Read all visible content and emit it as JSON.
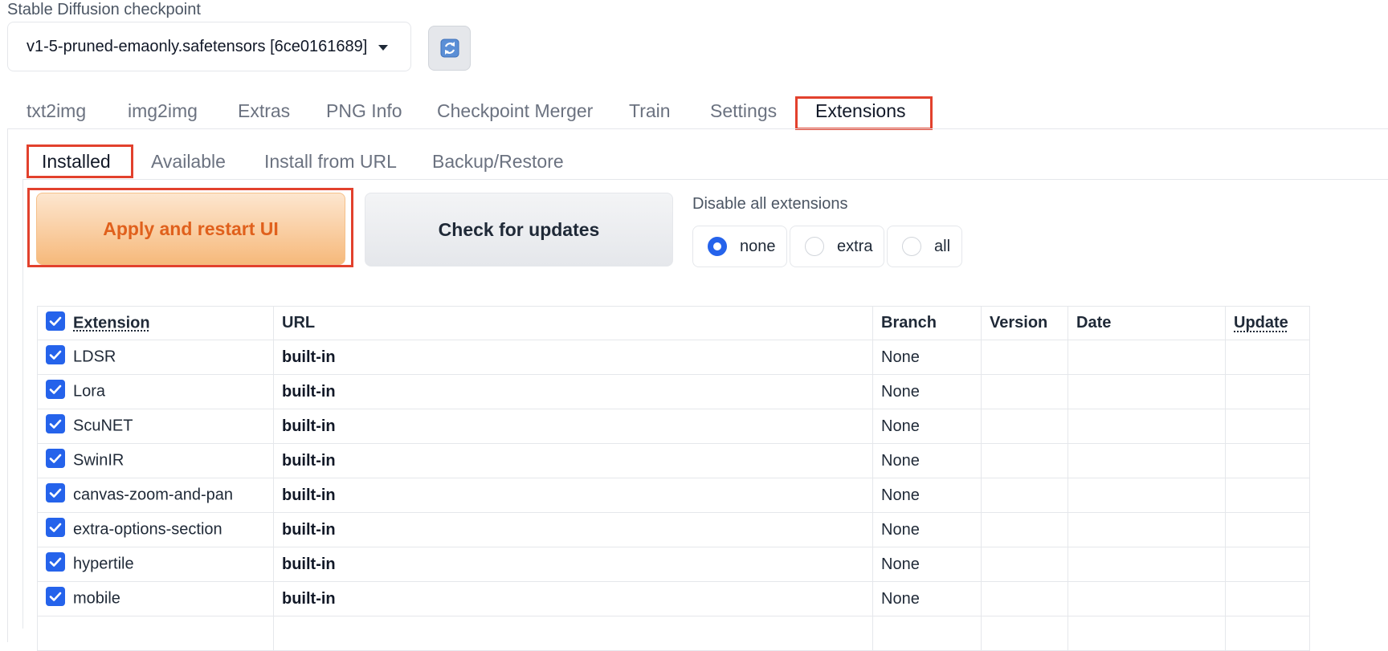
{
  "checkpoint": {
    "label": "Stable Diffusion checkpoint",
    "value": "v1-5-pruned-emaonly.safetensors [6ce0161689]"
  },
  "tabs": [
    {
      "label": "txt2img"
    },
    {
      "label": "img2img"
    },
    {
      "label": "Extras"
    },
    {
      "label": "PNG Info"
    },
    {
      "label": "Checkpoint Merger"
    },
    {
      "label": "Train"
    },
    {
      "label": "Settings"
    },
    {
      "label": "Extensions"
    }
  ],
  "subtabs": [
    {
      "label": "Installed"
    },
    {
      "label": "Available"
    },
    {
      "label": "Install from URL"
    },
    {
      "label": "Backup/Restore"
    }
  ],
  "actions": {
    "apply_label": "Apply and restart UI",
    "check_label": "Check for updates"
  },
  "disable": {
    "label": "Disable all extensions",
    "options": [
      "none",
      "extra",
      "all"
    ],
    "selected": "none"
  },
  "table": {
    "headers": [
      "Extension",
      "URL",
      "Branch",
      "Version",
      "Date",
      "Update"
    ],
    "rows": [
      {
        "name": "LDSR",
        "url": "built-in",
        "branch": "None",
        "version": "",
        "date": "",
        "update": ""
      },
      {
        "name": "Lora",
        "url": "built-in",
        "branch": "None",
        "version": "",
        "date": "",
        "update": ""
      },
      {
        "name": "ScuNET",
        "url": "built-in",
        "branch": "None",
        "version": "",
        "date": "",
        "update": ""
      },
      {
        "name": "SwinIR",
        "url": "built-in",
        "branch": "None",
        "version": "",
        "date": "",
        "update": ""
      },
      {
        "name": "canvas-zoom-and-pan",
        "url": "built-in",
        "branch": "None",
        "version": "",
        "date": "",
        "update": ""
      },
      {
        "name": "extra-options-section",
        "url": "built-in",
        "branch": "None",
        "version": "",
        "date": "",
        "update": ""
      },
      {
        "name": "hypertile",
        "url": "built-in",
        "branch": "None",
        "version": "",
        "date": "",
        "update": ""
      },
      {
        "name": "mobile",
        "url": "built-in",
        "branch": "None",
        "version": "",
        "date": "",
        "update": ""
      },
      {
        "name": "",
        "url": "",
        "branch": "",
        "version": "",
        "date": "",
        "update": ""
      }
    ]
  },
  "colors": {
    "accent": "#2563eb",
    "highlight": "#e2412d",
    "apply_text": "#e0601c"
  }
}
